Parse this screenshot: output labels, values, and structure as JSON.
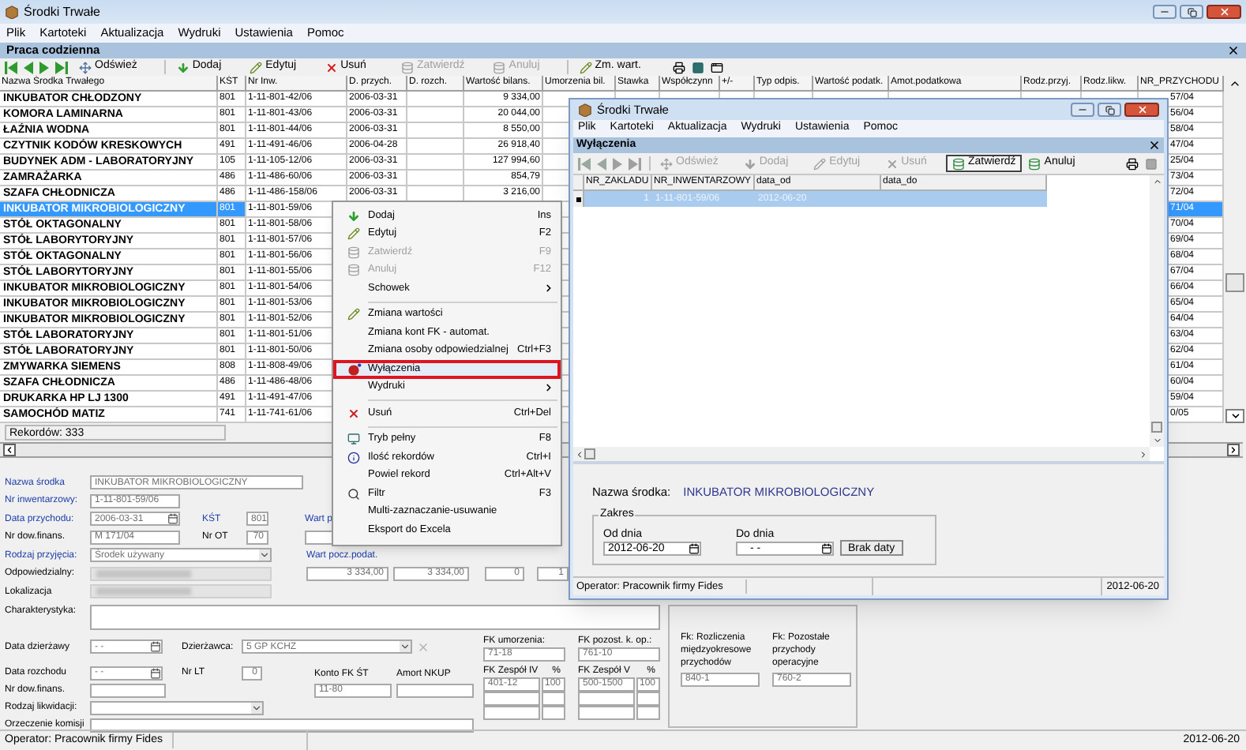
{
  "window": {
    "title": "Środki Trwałe"
  },
  "menu": [
    "Plik",
    "Kartoteki",
    "Aktualizacja",
    "Wydruki",
    "Ustawienia",
    "Pomoc"
  ],
  "panel": {
    "title": "Praca codzienna"
  },
  "toolbar": [
    {
      "label": "Odśwież",
      "disabled": false
    },
    {
      "label": "Dodaj",
      "disabled": false
    },
    {
      "label": "Edytuj",
      "disabled": false
    },
    {
      "label": "Usuń",
      "disabled": false
    },
    {
      "label": "Zatwierdź",
      "disabled": true
    },
    {
      "label": "Anuluj",
      "disabled": true
    },
    {
      "label": "Zm. wart.",
      "disabled": false
    }
  ],
  "table": {
    "columns": [
      "Nazwa Środka Trwałego",
      "KŚT",
      "Nr Inw.",
      "D. przych.",
      "D. rozch.",
      "Wartość bilans.",
      "Umorzenia bil.",
      "Stawka",
      "Współczynn",
      "+/-",
      "Typ odpis.",
      "Wartość podatk.",
      "Amot.podatkowa",
      "Rodz.przyj.",
      "Rodz.likw.",
      "NR_PRZYCHODU"
    ],
    "rows": [
      {
        "name": "INKUBATOR CHŁODZONY",
        "kst": "801",
        "nr_inw": "1-11-801-42/06",
        "d_przych": "2006-03-31",
        "wartosc": "9 334,00",
        "nr_przychodu": "57/04",
        "selected": false
      },
      {
        "name": "KOMORA LAMINARNA",
        "kst": "801",
        "nr_inw": "1-11-801-43/06",
        "d_przych": "2006-03-31",
        "wartosc": "20 044,00",
        "nr_przychodu": "56/04",
        "selected": false
      },
      {
        "name": "ŁAŹNIA WODNA",
        "kst": "801",
        "nr_inw": "1-11-801-44/06",
        "d_przych": "2006-03-31",
        "wartosc": "8 550,00",
        "nr_przychodu": "58/04",
        "selected": false
      },
      {
        "name": "CZYTNIK KODÓW KRESKOWYCH",
        "kst": "491",
        "nr_inw": "1-11-491-46/06",
        "d_przych": "2006-04-28",
        "wartosc": "26 918,40",
        "nr_przychodu": "47/04",
        "selected": false
      },
      {
        "name": "BUDYNEK ADM - LABORATORYJNY",
        "kst": "105",
        "nr_inw": "1-11-105-12/06",
        "d_przych": "2006-03-31",
        "wartosc": "127 994,60",
        "nr_przychodu": "25/04",
        "selected": false
      },
      {
        "name": "ZAMRAŻARKA",
        "kst": "486",
        "nr_inw": "1-11-486-60/06",
        "d_przych": "2006-03-31",
        "wartosc": "854,79",
        "nr_przychodu": "73/04",
        "selected": false
      },
      {
        "name": "SZAFA CHŁODNICZA",
        "kst": "486",
        "nr_inw": "1-11-486-158/06",
        "d_przych": "2006-03-31",
        "wartosc": "3 216,00",
        "nr_przychodu": "72/04",
        "selected": false
      },
      {
        "name": "INKUBATOR MIKROBIOLOGICZNY",
        "kst": "801",
        "nr_inw": "1-11-801-59/06",
        "nr_przychodu": "71/04",
        "selected": true
      },
      {
        "name": "STÓŁ OKTAGONALNY",
        "kst": "801",
        "nr_inw": "1-11-801-58/06",
        "nr_przychodu": "70/04",
        "selected": false
      },
      {
        "name": "STÓŁ LABORYTORYJNY",
        "kst": "801",
        "nr_inw": "1-11-801-57/06",
        "nr_przychodu": "69/04",
        "selected": false
      },
      {
        "name": "STÓŁ OKTAGONALNY",
        "kst": "801",
        "nr_inw": "1-11-801-56/06",
        "nr_przychodu": "68/04",
        "selected": false
      },
      {
        "name": "STÓŁ LABORYTORYJNY",
        "kst": "801",
        "nr_inw": "1-11-801-55/06",
        "nr_przychodu": "67/04",
        "selected": false
      },
      {
        "name": "INKUBATOR MIKROBIOLOGICZNY",
        "kst": "801",
        "nr_inw": "1-11-801-54/06",
        "nr_przychodu": "66/04",
        "selected": false
      },
      {
        "name": "INKUBATOR MIKROBIOLOGICZNY",
        "kst": "801",
        "nr_inw": "1-11-801-53/06",
        "nr_przychodu": "65/04",
        "selected": false
      },
      {
        "name": "INKUBATOR MIKROBIOLOGICZNY",
        "kst": "801",
        "nr_inw": "1-11-801-52/06",
        "nr_przychodu": "64/04",
        "selected": false
      },
      {
        "name": "STÓŁ LABORATORYJNY",
        "kst": "801",
        "nr_inw": "1-11-801-51/06",
        "nr_przychodu": "63/04",
        "selected": false
      },
      {
        "name": "STÓŁ LABORATORYJNY",
        "kst": "801",
        "nr_inw": "1-11-801-50/06",
        "nr_przychodu": "62/04",
        "selected": false
      },
      {
        "name": "ZMYWARKA SIEMENS",
        "kst": "808",
        "nr_inw": "1-11-808-49/06",
        "nr_przychodu": "61/04",
        "selected": false
      },
      {
        "name": "SZAFA CHŁODNICZA",
        "kst": "486",
        "nr_inw": "1-11-486-48/06",
        "nr_przychodu": "60/04",
        "selected": false
      },
      {
        "name": "DRUKARKA HP LJ 1300",
        "kst": "491",
        "nr_inw": "1-11-491-47/06",
        "nr_przychodu": "59/04",
        "selected": false
      },
      {
        "name": "SAMOCHÓD MATIZ",
        "kst": "741",
        "nr_inw": "1-11-741-61/06",
        "nr_przychodu": "0/05",
        "selected": false
      }
    ],
    "record_count": "Rekordów: 333"
  },
  "form": {
    "name": {
      "label": "Nazwa środka",
      "value": "INKUBATOR MIKROBIOLOGICZNY",
      "required": true
    },
    "inventory_no": {
      "label": "Nr inwentarzowy:",
      "value": "1-11-801-59/06",
      "required": true
    },
    "receipt_date": {
      "label": "Data przychodu:",
      "value": "2006-03-31",
      "required": true
    },
    "kst": {
      "label": "KŚT",
      "value": "801",
      "required": true
    },
    "wart_p": {
      "label": "Wart p",
      "required": true
    },
    "fin_doc": {
      "label": "Nr dow.finans.",
      "value": "M 171/04",
      "required": false
    },
    "nr_ot": {
      "label": "Nr OT",
      "value": "70",
      "required": false
    },
    "receipt_type": {
      "label": "Rodzaj przyjęcia:",
      "value": "Środek używany",
      "required": true
    },
    "tax_value": {
      "label": "Wart pocz.podat.",
      "required": true
    },
    "tax_values": [
      "3 334,00",
      "3 334,00",
      "0",
      "1"
    ],
    "responsible": {
      "label": "Odpowiedzialny:",
      "required": false
    },
    "location": {
      "label": "Lokalizacja",
      "required": false
    },
    "description": {
      "label": "Charakterystyka:",
      "required": false
    },
    "lease_date": {
      "label": "Data dzierżawy",
      "value": "- -",
      "required": false
    },
    "lessee": {
      "label": "Dzierżawca:",
      "value": "5 GP KCHZ",
      "required": false
    },
    "disposal_date": {
      "label": "Data rozchodu",
      "value": "- -",
      "required": false
    },
    "nr_lt": {
      "label": "Nr LT",
      "value": "0",
      "required": false
    },
    "disposal_doc": {
      "label": "Nr dow.finans.",
      "required": false
    },
    "fk_account": {
      "label": "Konto FK ŚT",
      "value": "11-80",
      "required": false
    },
    "amort_nkup": {
      "label": "Amort NKUP",
      "required": false
    },
    "liquidation_type": {
      "label": "Rodzaj likwidacji:",
      "required": false
    },
    "commission": {
      "label": "Orzeczenie komisji",
      "required": false
    },
    "fk_columns": [
      {
        "label": "FK umorzenia:",
        "value": "71-18",
        "team_label": "FK Zespół IV",
        "percent_label": "%",
        "team_value": "401-12",
        "percent": "100"
      },
      {
        "label": "FK pozost. k. op.:",
        "value": "761-10",
        "team_label": "FK Zespół V",
        "percent_label": "%",
        "team_value": "500-1500",
        "percent": "100"
      }
    ],
    "fk_panel": [
      {
        "label": "Fk: Rozliczenia międzyokresowe przychodów",
        "value": "840-1"
      },
      {
        "label": "Fk: Pozostałe przychody operacyjne",
        "value": "760-2"
      }
    ]
  },
  "status_bar": {
    "operator": "Operator: Pracownik firmy Fides",
    "date": "2012-06-20"
  },
  "context_menu": {
    "items": [
      {
        "kind": "item",
        "label": "Dodaj",
        "shortcut": "Ins",
        "disabled": false,
        "highlighted": false
      },
      {
        "kind": "item",
        "label": "Edytuj",
        "shortcut": "F2",
        "disabled": false,
        "highlighted": false
      },
      {
        "kind": "item",
        "label": "Zatwierdź",
        "shortcut": "F9",
        "disabled": true,
        "highlighted": false
      },
      {
        "kind": "item",
        "label": "Anuluj",
        "shortcut": "F12",
        "disabled": true,
        "highlighted": false
      },
      {
        "kind": "submenu",
        "label": "Schowek",
        "disabled": false,
        "highlighted": false
      },
      {
        "kind": "separator"
      },
      {
        "kind": "item",
        "label": "Zmiana wartości",
        "disabled": false,
        "highlighted": false
      },
      {
        "kind": "item",
        "label": "Zmiana kont FK - automat.",
        "disabled": false,
        "highlighted": false
      },
      {
        "kind": "item",
        "label": "Zmiana osoby odpowiedzialnej",
        "shortcut": "Ctrl+F3",
        "disabled": false,
        "highlighted": false
      },
      {
        "kind": "item",
        "label": "Wyłączenia",
        "disabled": false,
        "highlighted": true
      },
      {
        "kind": "submenu",
        "label": "Wydruki",
        "disabled": false,
        "highlighted": false
      },
      {
        "kind": "separator"
      },
      {
        "kind": "item",
        "label": "Usuń",
        "shortcut": "Ctrl+Del",
        "disabled": false,
        "highlighted": false
      },
      {
        "kind": "separator"
      },
      {
        "kind": "item",
        "label": "Tryb pełny",
        "shortcut": "F8",
        "disabled": false,
        "highlighted": false
      },
      {
        "kind": "item",
        "label": "Ilość rekordów",
        "shortcut": "Ctrl+I",
        "disabled": false,
        "highlighted": false
      },
      {
        "kind": "item",
        "label": "Powiel rekord",
        "shortcut": "Ctrl+Alt+V",
        "disabled": false,
        "highlighted": false
      },
      {
        "kind": "item",
        "label": "Filtr",
        "shortcut": "F3",
        "disabled": false,
        "highlighted": false
      },
      {
        "kind": "item",
        "label": "Multi-zaznaczanie-usuwanie",
        "disabled": false,
        "highlighted": false
      },
      {
        "kind": "item",
        "label": "Eksport do Excela",
        "disabled": false,
        "highlighted": false
      }
    ]
  },
  "dialog": {
    "title": "Środki Trwałe",
    "menu": [
      "Plik",
      "Kartoteki",
      "Aktualizacja",
      "Wydruki",
      "Ustawienia",
      "Pomoc"
    ],
    "panel_title": "Wyłączenia",
    "toolbar": [
      {
        "label": "Odśwież",
        "disabled": true,
        "default": false
      },
      {
        "label": "Dodaj",
        "disabled": true,
        "default": false
      },
      {
        "label": "Edytuj",
        "disabled": true,
        "default": false
      },
      {
        "label": "Usuń",
        "disabled": true,
        "default": false
      },
      {
        "label": "Zatwierdź",
        "disabled": false,
        "default": true
      },
      {
        "label": "Anuluj",
        "disabled": false,
        "default": false
      }
    ],
    "columns": [
      "NR_ZAKLADU",
      "NR_INWENTARZOWY",
      "data_od",
      "data_do"
    ],
    "rows": [
      {
        "cells": [
          "1",
          "1-11-801-59/06",
          "2012-06-20"
        ],
        "selected": true
      }
    ],
    "asset_label": "Nazwa środka:",
    "asset_name": "INKUBATOR MIKROBIOLOGICZNY",
    "range": {
      "title": "Zakres",
      "from_label": "Od dnia",
      "from_value": "2012-06-20",
      "to_label": "Do dnia",
      "to_value": "- -",
      "clear_button": "Brak daty"
    },
    "status_bar": {
      "operator": "Operator: Pracownik firmy Fides",
      "date": "2012-06-20"
    }
  }
}
